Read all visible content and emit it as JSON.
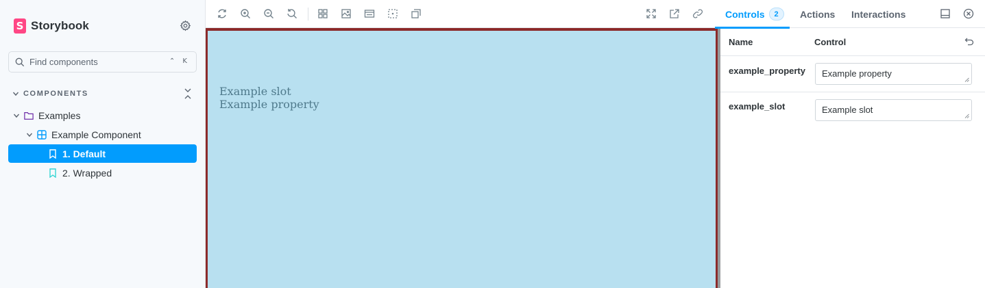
{
  "sidebar": {
    "brand": "Storybook",
    "search": {
      "placeholder": "Find components",
      "shortcut": "⌃ K"
    },
    "section_title": "COMPONENTS",
    "tree": [
      {
        "label": "Examples",
        "icon": "folder-icon"
      },
      {
        "label": "Example Component",
        "icon": "component-icon"
      },
      {
        "label": "1. Default",
        "icon": "bookmark-icon",
        "selected": true
      },
      {
        "label": "2. Wrapped",
        "icon": "bookmark-icon",
        "selected": false
      }
    ]
  },
  "toolbar": {
    "left_icons": [
      "reload-icon",
      "zoom-in-icon",
      "zoom-out-icon",
      "zoom-reset-icon",
      "grid-icon",
      "background-icon",
      "viewport-icon",
      "outline-icon",
      "measure-icon"
    ],
    "right_icons": [
      "fullscreen-icon",
      "open-new-tab-icon",
      "copy-link-icon"
    ]
  },
  "preview": {
    "lines": [
      "Example slot",
      "Example property"
    ]
  },
  "panel": {
    "tabs": [
      {
        "label": "Controls",
        "badge": "2",
        "active": true
      },
      {
        "label": "Actions",
        "active": false
      },
      {
        "label": "Interactions",
        "active": false
      }
    ],
    "header": {
      "name": "Name",
      "control": "Control"
    },
    "controls": [
      {
        "name": "example_property",
        "value": "Example property"
      },
      {
        "name": "example_slot",
        "value": "Example slot"
      }
    ]
  },
  "colors": {
    "accent": "#029cfd",
    "brand": "#ff4785",
    "preview_bg": "#b8e0f0",
    "preview_border": "#8c2a2a"
  }
}
